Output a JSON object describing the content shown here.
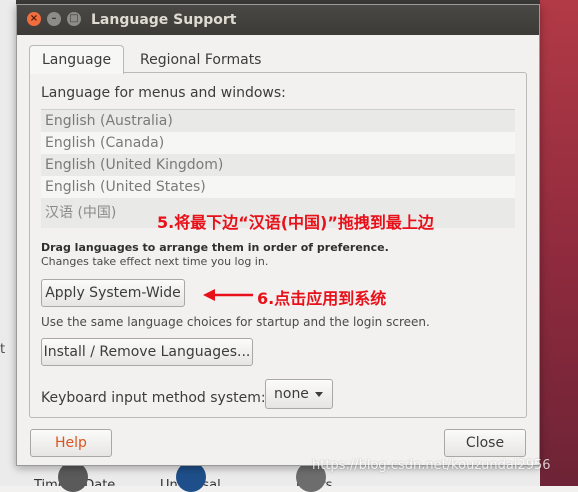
{
  "window": {
    "title": "Language Support"
  },
  "tabs": [
    {
      "label": "Language",
      "active": true
    },
    {
      "label": "Regional Formats",
      "active": false
    }
  ],
  "language_tab": {
    "heading": "Language for menus and windows:",
    "languages": [
      "English (Australia)",
      "English (Canada)",
      "English (United Kingdom)",
      "English (United States)",
      "汉语 (中国)"
    ],
    "drag_note_bold": "Drag languages to arrange them in order of preference.",
    "drag_note": "Changes take effect next time you log in.",
    "apply_button": "Apply System-Wide",
    "apply_description": "Use the same language choices for startup and the login screen.",
    "install_button": "Install / Remove Languages...",
    "keyboard_label": "Keyboard input method system:",
    "keyboard_value": "none"
  },
  "footer": {
    "help_button": "Help",
    "close_button": "Close"
  },
  "annotations": {
    "step5": "5.将最下边“汉语(中国)”拖拽到最上边",
    "step6": "6.点击应用到系统",
    "color": "#e8111a"
  },
  "background": {
    "left_fragment": "t",
    "bottom_labels": [
      "Time & Date",
      "Universal",
      "Users"
    ],
    "watermark": "https://blog.csdn.net/kouzundai2956"
  },
  "colors": {
    "titlebar": "#3c3b37",
    "help_text": "#d9551f",
    "desktop_accent": "#b23a46"
  }
}
